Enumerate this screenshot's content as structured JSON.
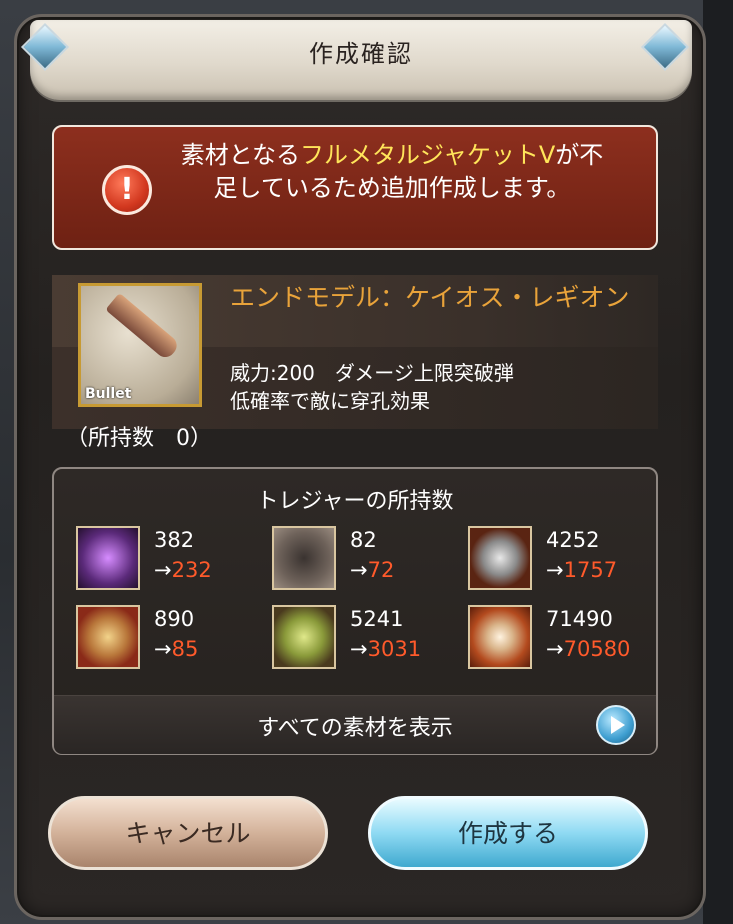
{
  "dialog": {
    "title": "作成確認"
  },
  "warning": {
    "text_before": "素材となる",
    "highlight": "フルメタルジャケットV",
    "text_after": "が不足しているため追加作成します。"
  },
  "item": {
    "name": "エンドモデル：ケイオス・レギオン",
    "icon_tag": "Bullet",
    "desc_line1": "威力:200　ダメージ上限突破弾",
    "desc_line2": "低確率で敵に穿孔効果",
    "owned": "（所持数　0）"
  },
  "treasures": {
    "title": "トレジャーの所持数",
    "arrow": "→",
    "items": [
      {
        "icon": "dark-sword-crystal-icon",
        "count": "382",
        "after": "232",
        "color": "#5b2a7a"
      },
      {
        "icon": "dark-ore-icon",
        "count": "82",
        "after": "72",
        "color": "#5a4d45"
      },
      {
        "icon": "silver-nugget-icon",
        "count": "4252",
        "after": "1757",
        "color": "#5a2412"
      },
      {
        "icon": "gold-bar-icon",
        "count": "890",
        "after": "85",
        "color": "#8a2a18"
      },
      {
        "icon": "green-box-icon",
        "count": "5241",
        "after": "3031",
        "color": "#6a7a2a"
      },
      {
        "icon": "pearl-orb-icon",
        "count": "71490",
        "after": "70580",
        "color": "#b34a1e"
      }
    ],
    "show_all": "すべての素材を表示"
  },
  "buttons": {
    "cancel": "キャンセル",
    "create": "作成する"
  }
}
